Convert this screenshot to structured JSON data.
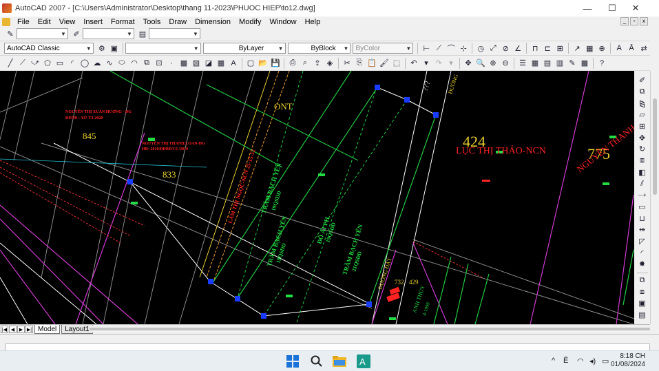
{
  "window": {
    "title": "AutoCAD 2007 - [C:\\Users\\Administrator\\Desktop\\thang 11-2023\\PHUOC HIEP\\to12.dwg]",
    "minimize_glyph": "—",
    "maximize_glyph": "☐",
    "close_glyph": "✕"
  },
  "menu": {
    "items": [
      "File",
      "Edit",
      "View",
      "Insert",
      "Format",
      "Tools",
      "Draw",
      "Dimension",
      "Modify",
      "Window",
      "Help"
    ]
  },
  "toolbar": {
    "workspace": "AutoCAD Classic",
    "linetype": "ByLayer",
    "lineweight": "ByBlock",
    "plotstyle": "ByColor"
  },
  "drawing": {
    "labels": {
      "ont": "ONT",
      "p424": "424",
      "owner_424": "LỤC THỊ THẢO-NCN",
      "p775": "775",
      "owner_775": "NGUYỄN THANH",
      "p845": "845",
      "p833": "833",
      "p732": "732",
      "p429": "429",
      "owner_xuan_huong": "NGUYỄN THỊ XUÂN HƯƠNG - ĐG",
      "hd_xuan_huong": "HĐTĐ : 337-T3-2020",
      "owner_thanh_loan": "NGUYỄN THỊ THANH LOAN-ĐG",
      "hd_thanh_loan": "HĐ: 2010/ĐĐBĐ/CC/2019",
      "lam_thi_ngoc": "LÂM THỊ NGỌC-NCN 25-15-52",
      "tram_bach_yen_1": "TRẦM BẠCH YẾN",
      "qd_1": "19QSDD",
      "tram_bach_yen_2": "TRẦM BẠCH YẾN",
      "qd_2": "19QSDD",
      "do_ai_phuong": "ĐỖ ÁI PH",
      "qd_3": "19QSDD",
      "tram_bach_yen_3": "TRẦM BẠCH YẾN",
      "qd_4": "21QSDD",
      "duong_dat": "ĐƯỜNG ĐẤT",
      "duong": "ĐƯỜNG",
      "anh_thuy": "ANH THỦY",
      "year_1999": "4-1999",
      "question_marks": "???"
    }
  },
  "tabs": {
    "model": "Model",
    "layout1": "Layout1"
  },
  "clock": {
    "time": "8:18 CH",
    "date": "01/08/2024"
  }
}
